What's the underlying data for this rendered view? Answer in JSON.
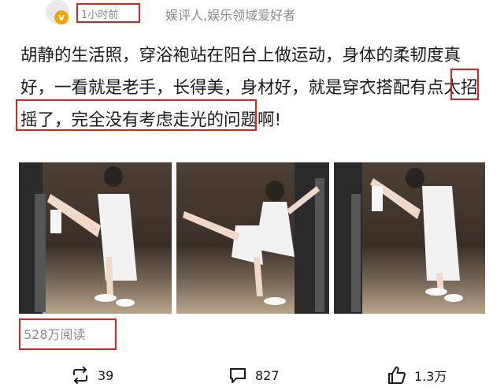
{
  "header": {
    "time": "1小时前",
    "author_desc": "娱评人,娱乐领域爱好者",
    "verified_icon": "verified-badge-icon"
  },
  "post": {
    "text": "胡静的生活照，穿浴袍站在阳台上做运动，身体的柔韧度真好，一看就是老手，长得美，身材好，就是穿衣搭配有点太招摇了，完全没有考虑走光的问题啊!"
  },
  "photos": [
    {
      "name": "photo-1"
    },
    {
      "name": "photo-2"
    },
    {
      "name": "photo-3"
    }
  ],
  "stats": {
    "reads": "528万阅读"
  },
  "actions": {
    "repost_count": "39",
    "comment_count": "827",
    "like_count": "1.3万"
  },
  "colors": {
    "highlight_border": "#e02020",
    "muted_text": "#8a8a8a",
    "verified": "#f5a300"
  }
}
